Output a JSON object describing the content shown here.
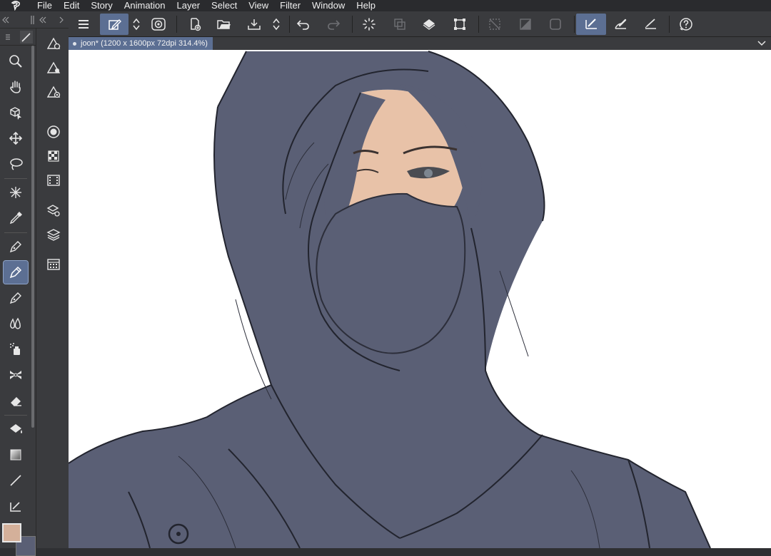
{
  "app": {
    "logo_icon": "clip-studio-logo-icon"
  },
  "menu": [
    "File",
    "Edit",
    "Story",
    "Animation",
    "Layer",
    "Select",
    "View",
    "Filter",
    "Window",
    "Help"
  ],
  "toolbar": {
    "icons": [
      "menu-icon",
      "edit-pen-icon",
      "stepper-icon",
      "spiral-icon",
      "new-document-icon",
      "open-folder-icon",
      "save-icon",
      "undo-icon",
      "redo-icon",
      "loading-icon",
      "copy-icon",
      "fill-icon",
      "transform-icon",
      "deselect-icon",
      "mask-icon",
      "frame-icon",
      "pen-tool-icon",
      "brush-tool-icon",
      "ruler-pen-icon",
      "help-icon"
    ],
    "accent_color": "#5c6f93"
  },
  "document": {
    "tab_label": "joon* (1200 x 1600px 72dpi 314.4%)"
  },
  "tools": [
    "zoom",
    "hand",
    "object",
    "move",
    "lasso",
    "magic-wand",
    "eyedropper",
    "pen",
    "pencil",
    "brush",
    "blend",
    "airbrush",
    "decoration",
    "eraser",
    "fill",
    "gradient",
    "line",
    "ruler"
  ],
  "active_tool": "pencil",
  "colors": {
    "main": "#d4b09a",
    "sub": "#5a5f75",
    "canvas_bg": "#ffffff",
    "hood": "#5a5f75",
    "skin": "#e8c2a8"
  }
}
